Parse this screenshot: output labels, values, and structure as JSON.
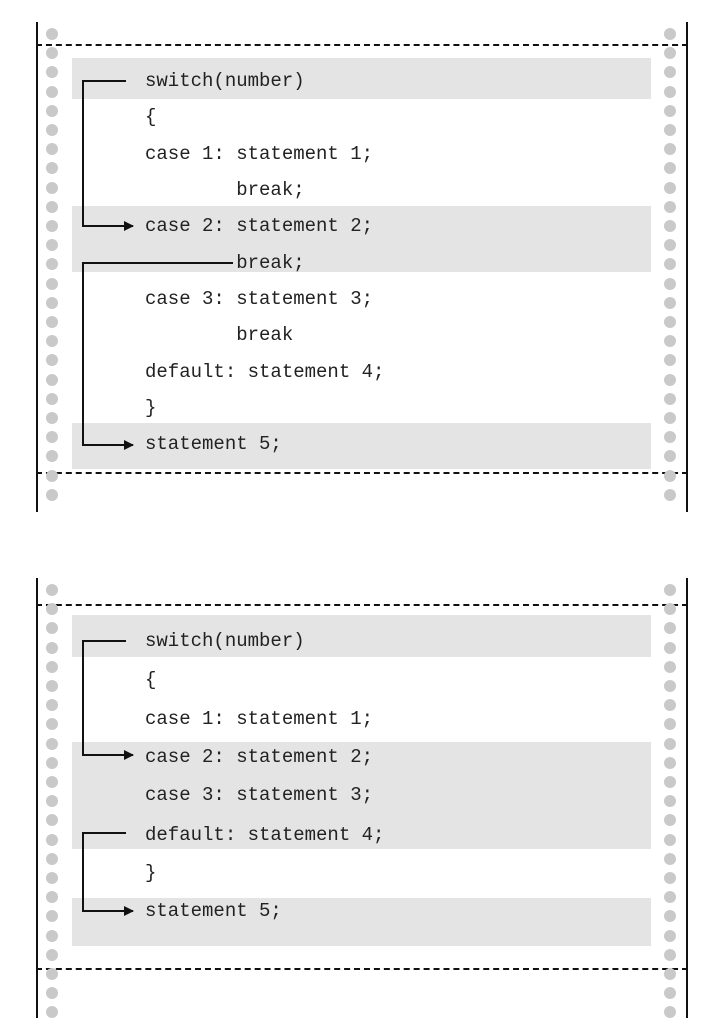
{
  "figures": [
    {
      "lines": [
        "switch(number)",
        "{",
        "case 1: statement 1;",
        "        break;",
        "case 2: statement 2;",
        "        break;",
        "case 3: statement 3;",
        "        break",
        "default: statement 4;",
        "}",
        "statement 5;"
      ]
    },
    {
      "lines": [
        "switch(number)",
        "{",
        "case 1: statement 1;",
        "case 2: statement 2;",
        "case 3: statement 3;",
        "default: statement 4;",
        "}",
        "statement 5;"
      ]
    }
  ],
  "colors": {
    "band": "#e4e4e4",
    "hole": "#c9c9c9",
    "ink": "#111111",
    "text": "#222222"
  }
}
